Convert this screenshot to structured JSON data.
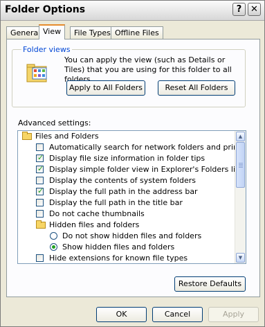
{
  "window": {
    "title": "Folder Options",
    "help_btn": "?",
    "close_btn": "✕"
  },
  "tabs": [
    {
      "label": "General",
      "active": false
    },
    {
      "label": "View",
      "active": true
    },
    {
      "label": "File Types",
      "active": false
    },
    {
      "label": "Offline Files",
      "active": false
    }
  ],
  "folder_views": {
    "group_label": "Folder views",
    "description": "You can apply the view (such as Details or Tiles) that you are using for this folder to all folders.",
    "apply_button": "Apply to All Folders",
    "reset_button": "Reset All Folders"
  },
  "advanced": {
    "label": "Advanced settings:",
    "items": [
      {
        "kind": "folder",
        "label": "Files and Folders"
      },
      {
        "kind": "checkbox",
        "label": "Automatically search for network folders and printers",
        "checked": false
      },
      {
        "kind": "checkbox",
        "label": "Display file size information in folder tips",
        "checked": true
      },
      {
        "kind": "checkbox",
        "label": "Display simple folder view in Explorer's Folders list",
        "checked": true
      },
      {
        "kind": "checkbox",
        "label": "Display the contents of system folders",
        "checked": false
      },
      {
        "kind": "checkbox",
        "label": "Display the full path in the address bar",
        "checked": true
      },
      {
        "kind": "checkbox",
        "label": "Display the full path in the title bar",
        "checked": false
      },
      {
        "kind": "checkbox",
        "label": "Do not cache thumbnails",
        "checked": false
      },
      {
        "kind": "subfolder",
        "label": "Hidden files and folders"
      },
      {
        "kind": "radio",
        "label": "Do not show hidden files and folders",
        "checked": false
      },
      {
        "kind": "radio",
        "label": "Show hidden files and folders",
        "checked": true
      },
      {
        "kind": "checkbox",
        "label": "Hide extensions for known file types",
        "checked": false
      }
    ],
    "restore_button": "Restore Defaults"
  },
  "footer": {
    "ok": "OK",
    "cancel": "Cancel",
    "apply": "Apply"
  },
  "colors": {
    "window_bg": "#ece9d8",
    "group_label": "#0046d5",
    "check_mark": "#21a121",
    "tab_highlight": "#e68b2c"
  }
}
